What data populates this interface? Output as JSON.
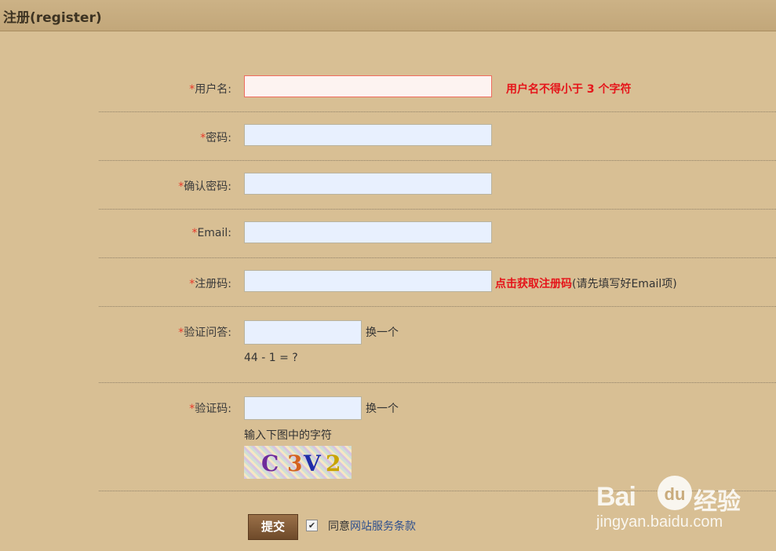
{
  "header": {
    "title": "注册(register)"
  },
  "required_mark": "*",
  "form": {
    "username": {
      "label": "用户名:",
      "value": "",
      "error": "用户名不得小于 3 个字符"
    },
    "password": {
      "label": "密码:",
      "value": ""
    },
    "confirm_password": {
      "label": "确认密码:",
      "value": ""
    },
    "email": {
      "label": "Email:",
      "value": ""
    },
    "reg_code": {
      "label": "注册码:",
      "value": "",
      "link": "点击获取注册码",
      "note": "(请先填写好Email项)"
    },
    "qa": {
      "label": "验证问答:",
      "value": "",
      "change_link": "换一个",
      "question": "44 - 1 = ?"
    },
    "captcha": {
      "label": "验证码:",
      "value": "",
      "change_link": "换一个",
      "hint": "输入下图中的字符",
      "chars": [
        "C",
        "3",
        "V",
        "2"
      ]
    }
  },
  "submit_label": "提交",
  "agree": {
    "checked": true,
    "check_glyph": "✔",
    "prefix": "同意",
    "link": "网站服务条款"
  },
  "watermark": {
    "brand_left": "Bai",
    "brand_paw": "du",
    "brand_right": "经验",
    "url": "jingyan.baidu.com"
  }
}
